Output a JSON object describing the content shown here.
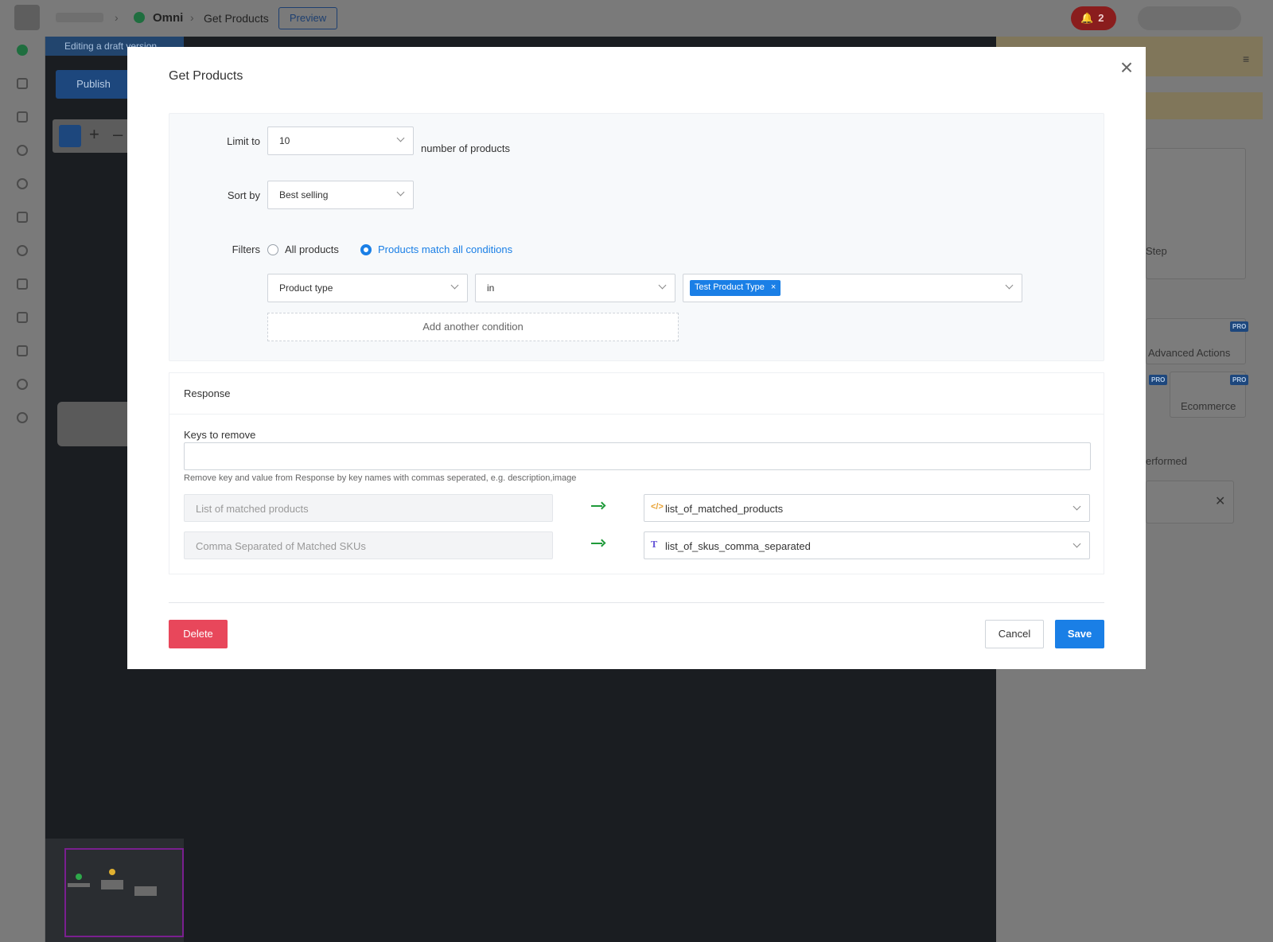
{
  "topbar": {
    "breadcrumb_app": "Omni",
    "breadcrumb_page": "Get Products",
    "preview_label": "Preview",
    "notification_count": "2"
  },
  "canvas": {
    "draft_notice": "Editing a draft version",
    "publish_label": "Publish"
  },
  "right_panel": {
    "step_fragment": "Step",
    "advanced_actions": "Advanced Actions",
    "ecommerce": "Ecommerce",
    "performed_fragment": "erformed",
    "pro_badge": "PRO"
  },
  "modal": {
    "title": "Get Products",
    "limit": {
      "label": "Limit to",
      "value": "10",
      "suffix": "number of products"
    },
    "sort": {
      "label": "Sort by",
      "value": "Best selling"
    },
    "filters": {
      "label": "Filters",
      "option_all": "All products",
      "option_match": "Products match all conditions",
      "selected": "Products match all conditions",
      "condition": {
        "field": "Product type",
        "operator": "in",
        "tag": "Test Product Type"
      },
      "add_condition_label": "Add another condition"
    },
    "response": {
      "title": "Response",
      "keys_label": "Keys to remove",
      "keys_value": "",
      "keys_help": "Remove key and value from Response by key names with commas seperated, e.g. description,image",
      "mappings": [
        {
          "source": "List of matched products",
          "target": "list_of_matched_products",
          "target_icon": "code-icon"
        },
        {
          "source": "Comma Separated of Matched SKUs",
          "target": "list_of_skus_comma_separated",
          "target_icon": "text-type-icon"
        }
      ]
    },
    "buttons": {
      "delete": "Delete",
      "cancel": "Cancel",
      "save": "Save"
    },
    "colors": {
      "primary": "#1a7fe6",
      "danger": "#e8475b",
      "arrow": "#1f9a3a"
    }
  }
}
